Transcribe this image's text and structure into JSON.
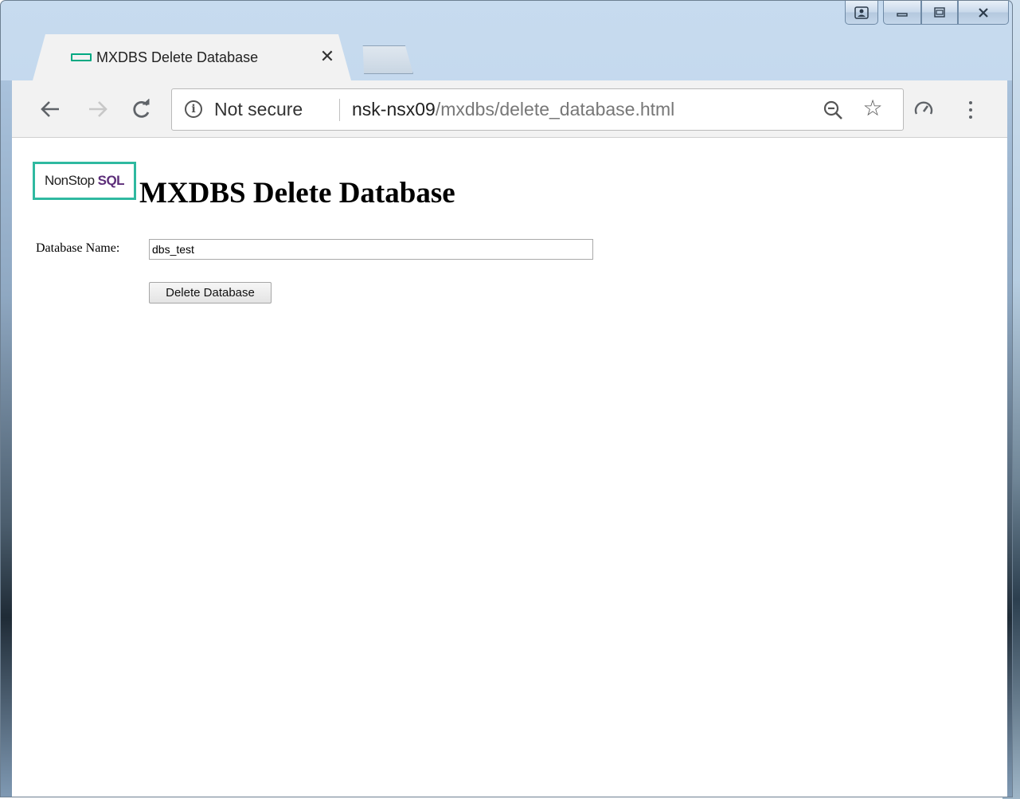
{
  "browser": {
    "tab": {
      "title": "MXDBS Delete Database",
      "close_glyph": "✕",
      "favicon": "hpe-green-rect-icon"
    },
    "nav": {
      "back_glyph": "←",
      "forward_glyph": "→",
      "reload_glyph": "C"
    },
    "omnibox": {
      "security_label": "Not secure",
      "url_host": "nsk-nsx09",
      "url_path": "/mxdbs/delete_database.html"
    },
    "icons": {
      "star_glyph": "☆",
      "zoom": "zoom-out-icon",
      "extension": "speedometer-icon",
      "menu": "kebab-menu-icon"
    }
  },
  "page": {
    "logo": {
      "word1": "NonStop",
      "word2": "SQL"
    },
    "heading": "MXDBS Delete Database",
    "form": {
      "label": "Database Name:",
      "input_value": "dbs_test",
      "button_label": "Delete Database"
    }
  },
  "colors": {
    "brand_green": "#2fb9a0",
    "sql_purple": "#5c2d79"
  }
}
